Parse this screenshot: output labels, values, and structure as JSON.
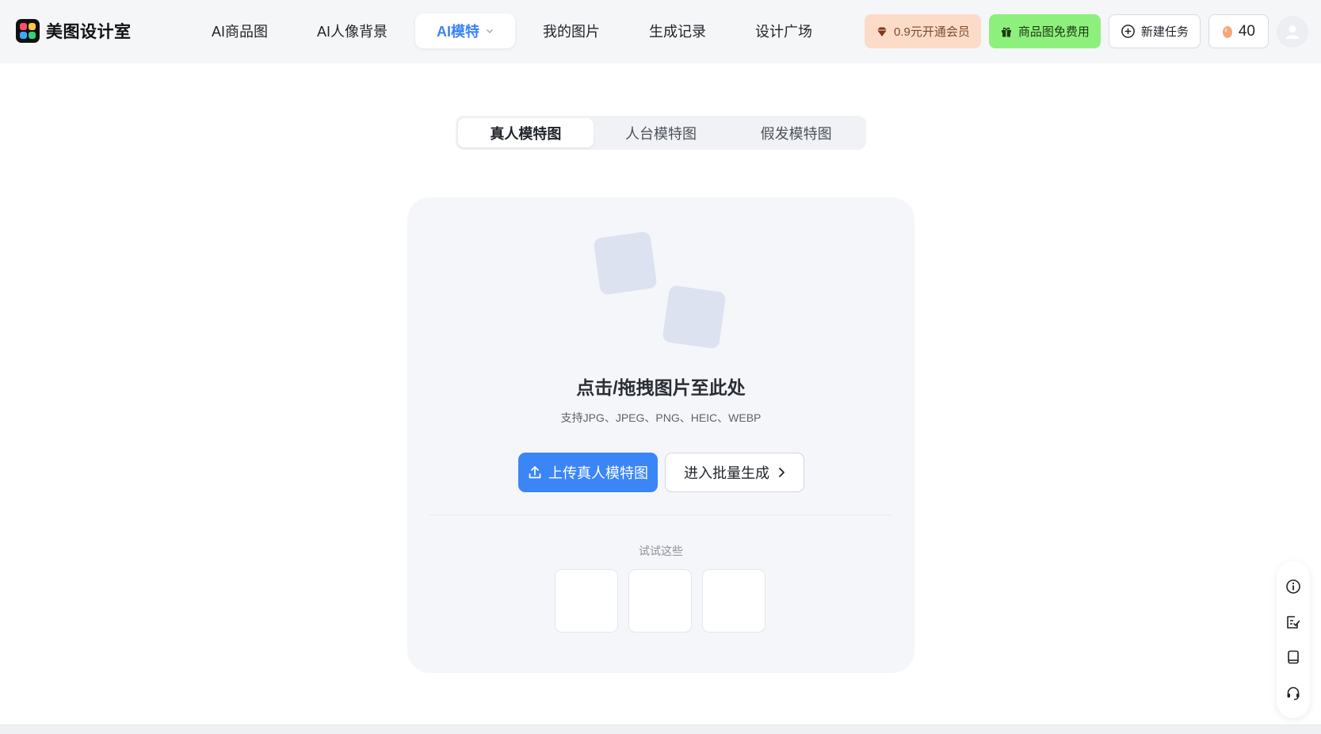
{
  "brand": {
    "name": "美图设计室"
  },
  "nav": {
    "items": [
      {
        "label": "AI商品图"
      },
      {
        "label": "AI人像背景"
      },
      {
        "label": "AI模特",
        "active": true
      },
      {
        "label": "我的图片"
      },
      {
        "label": "生成记录"
      },
      {
        "label": "设计广场"
      }
    ]
  },
  "header_actions": {
    "vip_label": "0.9元开通会员",
    "free_label": "商品图免费用",
    "new_task_label": "新建任务",
    "coin_count": "40"
  },
  "mode_tabs": {
    "items": [
      {
        "label": "真人模特图",
        "active": true
      },
      {
        "label": "人台模特图"
      },
      {
        "label": "假发模特图"
      }
    ]
  },
  "upload": {
    "title": "点击/拖拽图片至此处",
    "formats": "支持JPG、JPEG、PNG、HEIC、WEBP",
    "upload_button": "上传真人模特图",
    "batch_button": "进入批量生成",
    "try_label": "试试这些"
  },
  "float_bar": {
    "icons": [
      "info-icon",
      "checklist-icon",
      "book-icon",
      "headset-icon"
    ]
  },
  "colors": {
    "accent": "#3b86f7",
    "vip_bg": "#fcdcc8",
    "free_bg": "#8ef07c",
    "placeholder_square": "#dde2f0"
  }
}
